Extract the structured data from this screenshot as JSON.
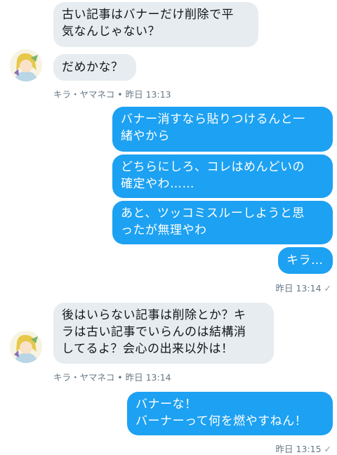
{
  "messages": [
    {
      "text": "古い記事はバナーだけ削除で平\n気なんじゃない？",
      "side": "in"
    },
    {
      "text": "だめかな？",
      "side": "in"
    },
    {
      "text": "バナー消すなら貼りつけるんと一\n緒やから",
      "side": "out"
    },
    {
      "text": "どちらにしろ、コレはめんどいの\n確定やわ……",
      "side": "out"
    },
    {
      "text": "あと、ツッコミスルーしようと思\nったが無理やわ",
      "side": "out"
    },
    {
      "text": "キラ…",
      "side": "out"
    },
    {
      "text": "後はいらない記事は削除とか？キ\nラは古い記事でいらんのは結構消\nしてるよ？会心の出来以外は！",
      "side": "in"
    },
    {
      "text": "バナーな！\nバーナーって何を燃やすねん！",
      "side": "out"
    }
  ],
  "meta": {
    "group1_sender": "キラ・ヤマネコ",
    "group1_time": "昨日 13:13",
    "group2_time": "昨日 13:14",
    "group3_sender": "キラ・ヤマネコ",
    "group3_time": "昨日 13:14",
    "group4_time": "昨日 13:15",
    "separator": "•",
    "check": "✓"
  },
  "colors": {
    "incoming_bubble": "#e6ecf0",
    "outgoing_bubble": "#1da1f2",
    "meta_text": "#657786"
  }
}
